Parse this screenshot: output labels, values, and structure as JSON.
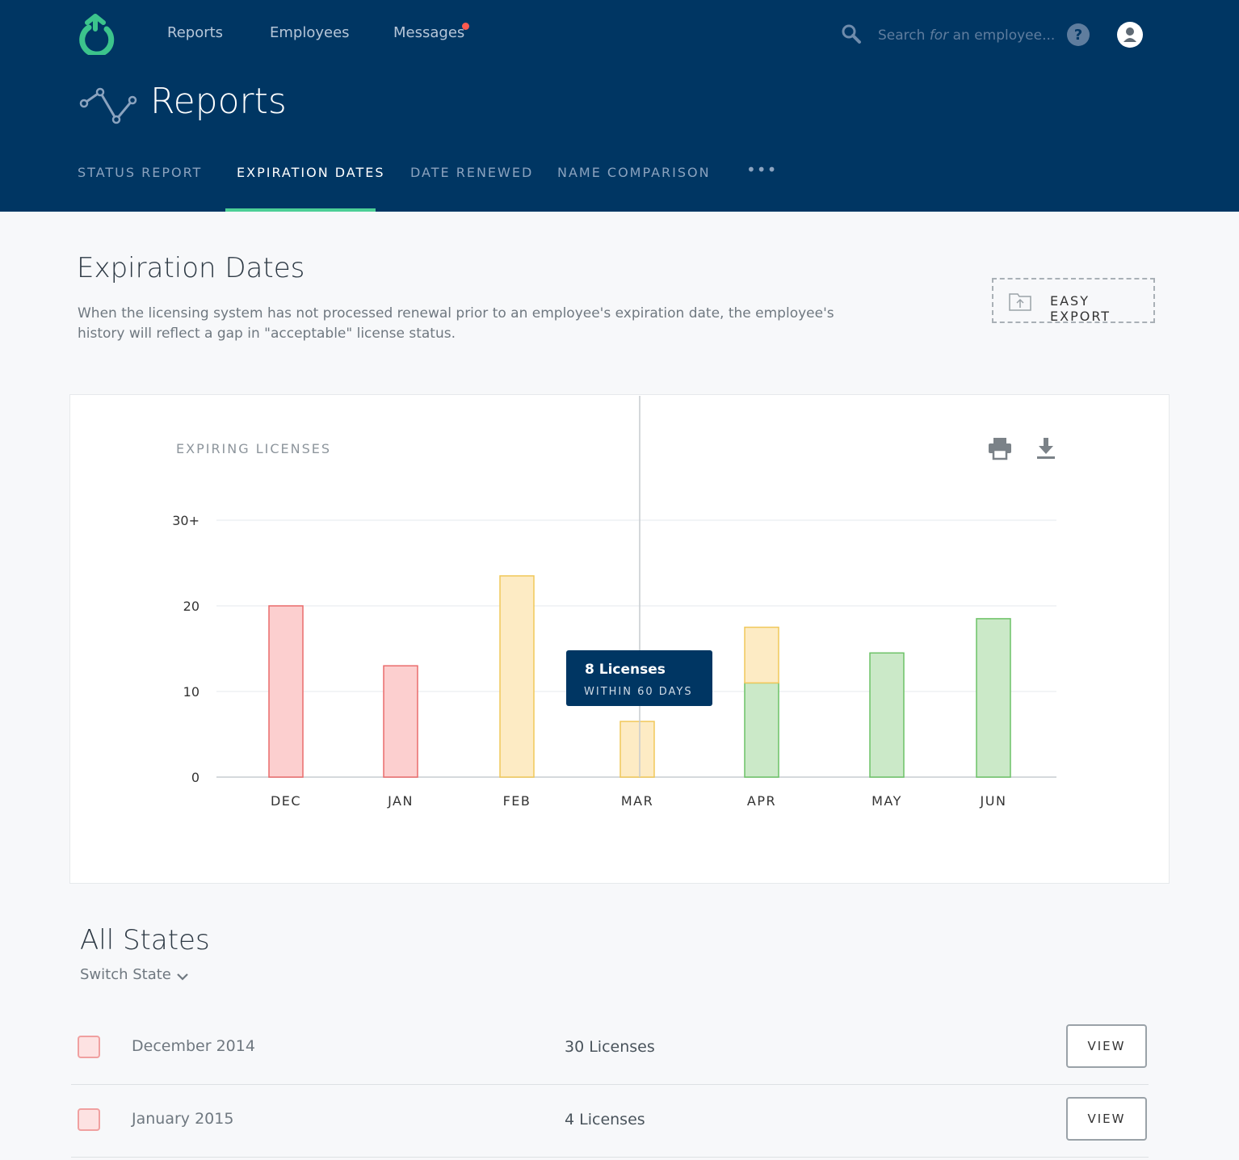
{
  "nav": {
    "links": [
      "Reports",
      "Employees",
      "Messages"
    ],
    "search_placeholder_pre": "Search",
    "search_placeholder_em": "for",
    "search_placeholder_post": "an employee..."
  },
  "header": {
    "title": "Reports",
    "tabs": [
      "STATUS REPORT",
      "EXPIRATION DATES",
      "DATE RENEWED",
      "NAME COMPARISON"
    ],
    "active_tab": "EXPIRATION DATES",
    "more_label": "•••"
  },
  "section": {
    "title": "Expiration Dates",
    "description": "When the licensing system has not processed renewal prior to an employee's expiration date, the employee's history will reflect a gap in \"acceptable\" license status.",
    "export_label": "EASY EXPORT"
  },
  "chart_data": {
    "type": "bar",
    "title": "EXPIRING LICENSES",
    "categories": [
      "DEC",
      "JAN",
      "FEB",
      "MAR",
      "APR",
      "MAY",
      "JUN"
    ],
    "series": [
      {
        "values": [
          20,
          13,
          0,
          0,
          0,
          0,
          0
        ]
      },
      {
        "values": [
          0,
          0,
          23.5,
          6.5,
          6.5,
          0,
          0
        ]
      },
      {
        "values": [
          0,
          0,
          0,
          0,
          11,
          14.5,
          18.5
        ]
      }
    ],
    "colors": {
      "red_fill": "#fccfcf",
      "red_stroke": "#ea6c6c",
      "yellow_fill": "#fdebc4",
      "yellow_stroke": "#f0c85a",
      "green_fill": "#cbe9c8",
      "green_stroke": "#6cc267"
    },
    "y_ticks": [
      "0",
      "10",
      "20",
      "30+"
    ],
    "ylim": [
      0,
      30
    ],
    "grid": true,
    "hover_category": "MAR",
    "tooltip": {
      "title": "8 Licenses",
      "subtitle": "WITHIN 60 DAYS"
    }
  },
  "states": {
    "title": "All States",
    "switch_label": "Switch State",
    "rows": [
      {
        "label": "December 2014",
        "count": "30 Licenses",
        "action": "VIEW"
      },
      {
        "label": "January 2015",
        "count": "4 Licenses",
        "action": "VIEW"
      }
    ]
  },
  "colors": {
    "header_bg": "#003663",
    "accent": "#4ccf96",
    "notification": "#ff5a4f"
  }
}
